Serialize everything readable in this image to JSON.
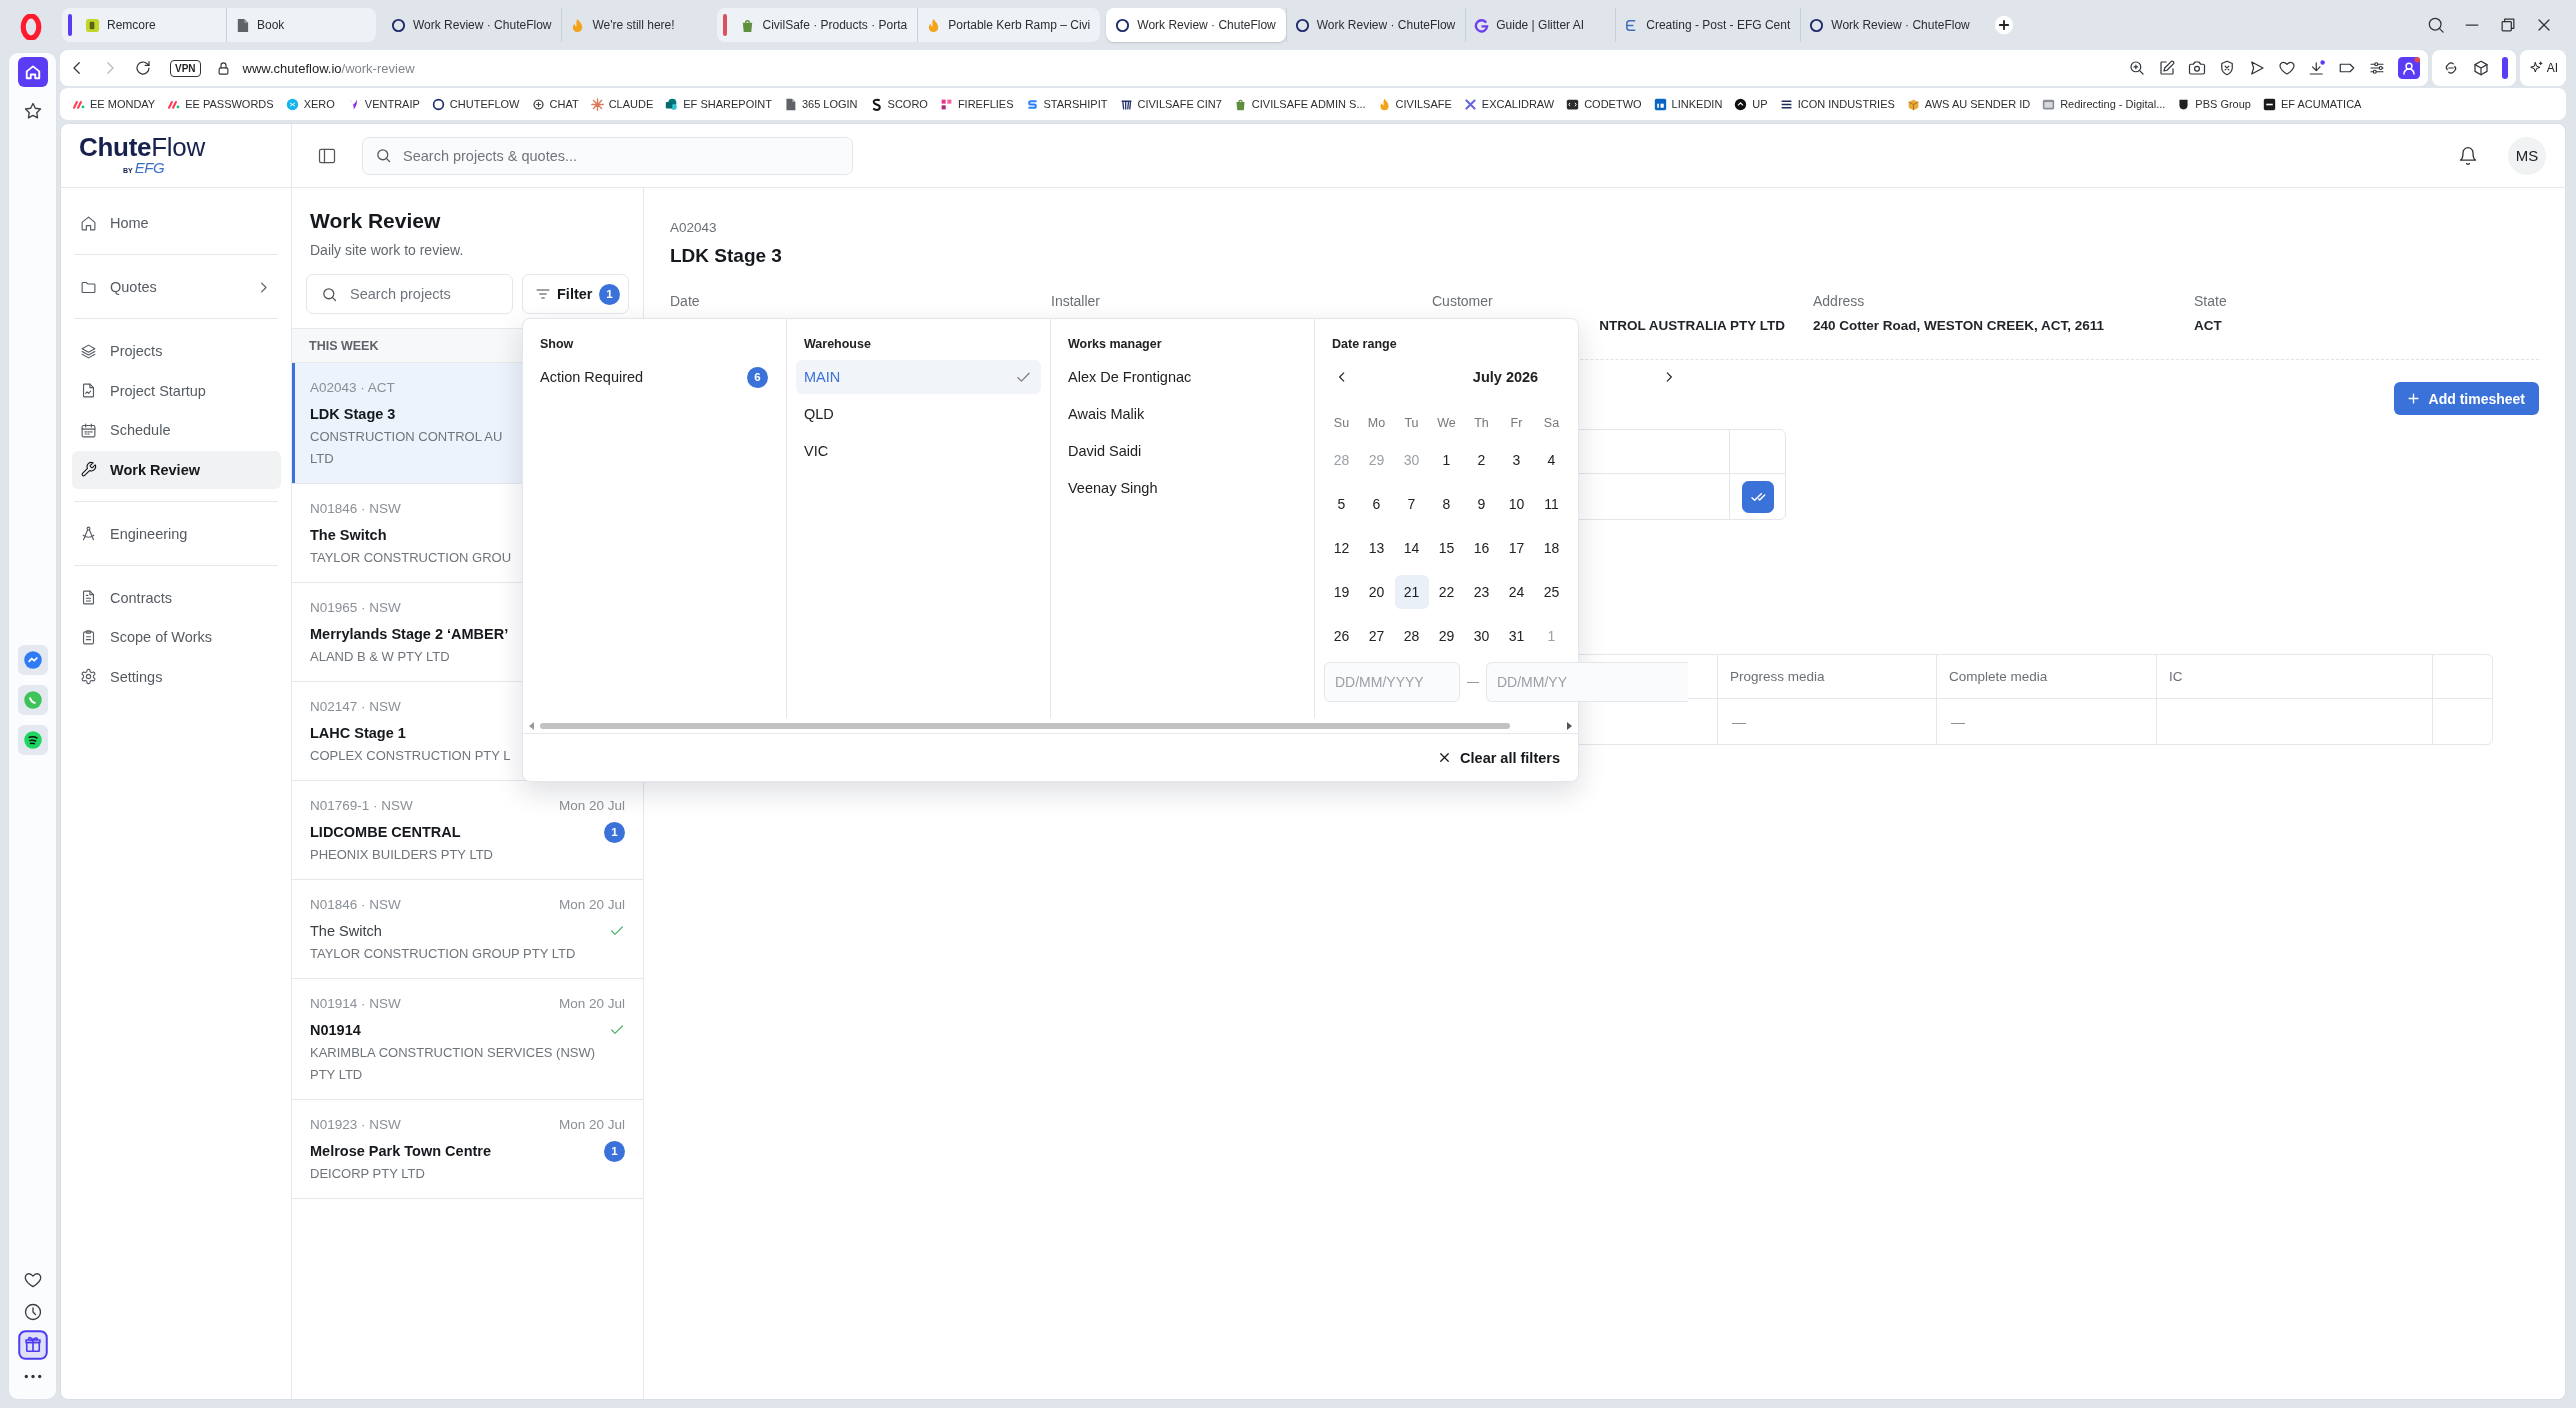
{
  "browser": {
    "tab_groups": [
      {
        "color": "#5b3cf5",
        "tabs": [
          {
            "title": "Remcore",
            "selected": false
          },
          {
            "title": "Book",
            "selected": false
          }
        ]
      },
      {
        "tabs": [
          {
            "title": "Work Review · ChuteFlow",
            "selected": false
          },
          {
            "title": "We're still here!",
            "selected": false
          }
        ]
      },
      {
        "color": "#d9525e",
        "tabs": [
          {
            "title": "CivilSafe · Products · Porta",
            "selected": false
          },
          {
            "title": "Portable Kerb Ramp – Civi",
            "selected": false
          }
        ]
      },
      {
        "tabs": [
          {
            "title": "Work Review · ChuteFlow",
            "selected": true
          },
          {
            "title": "Work Review · ChuteFlow",
            "selected": false
          },
          {
            "title": "Guide | Glitter AI",
            "selected": false
          },
          {
            "title": "Creating - Post - EFG Cent",
            "selected": false
          },
          {
            "title": "Work Review · ChuteFlow",
            "selected": false
          }
        ]
      }
    ],
    "toolbar": {
      "vpn_label": "VPN",
      "url_host": "www.chuteflow.io",
      "url_path": "/work-review",
      "ai_label": "AI"
    },
    "bookmarks": [
      "EE MONDAY",
      "EE PASSWORDS",
      "XERO",
      "VENTRAIP",
      "CHUTEFLOW",
      "CHAT",
      "CLAUDE",
      "EF SHAREPOINT",
      "365 LOGIN",
      "SCORO",
      "FIREFLIES",
      "STARSHIPIT",
      "CIVILSAFE CIN7",
      "CIVILSAFE ADMIN S...",
      "CIVILSAFE",
      "EXCALIDRAW",
      "CODETWO",
      "LINKEDIN",
      "UP",
      "ICON INDUSTRIES",
      "AWS AU SENDER ID",
      "Redirecting - Digital...",
      "PBS Group",
      "EF ACUMATICA"
    ]
  },
  "app": {
    "logo": {
      "name": "**Chute**Flow",
      "byline": "BY",
      "brand": "EFG"
    },
    "search": {
      "placeholder": "Search projects & quotes..."
    },
    "user": {
      "initials": "MS"
    },
    "sidebar": {
      "groups": [
        {
          "items": [
            {
              "label": "Home",
              "kind": "link",
              "selected": false
            }
          ]
        },
        {
          "items": [
            {
              "label": "Quotes",
              "kind": "menu",
              "selected": false
            }
          ]
        },
        {
          "items": [
            {
              "label": "Projects",
              "kind": "link",
              "selected": false
            },
            {
              "label": "Project Startup",
              "kind": "link",
              "selected": false
            },
            {
              "label": "Schedule",
              "kind": "link",
              "selected": false
            },
            {
              "label": "Work Review",
              "kind": "link",
              "selected": true
            }
          ]
        },
        {
          "items": [
            {
              "label": "Engineering",
              "kind": "link",
              "selected": false
            }
          ]
        },
        {
          "items": [
            {
              "label": "Contracts",
              "kind": "link",
              "selected": false
            },
            {
              "label": "Scope of Works",
              "kind": "link",
              "selected": false
            }
          ]
        }
      ],
      "footer": {
        "label": "Settings",
        "selected": false
      }
    },
    "list": {
      "title": "Work Review",
      "subtitle": "Daily site work to review.",
      "search": {
        "placeholder": "Search projects"
      },
      "filter": {
        "label": "Filter",
        "count": "1"
      },
      "section": "THIS WEEK",
      "items": [
        {
          "code": "A02043 · ACT",
          "title": "LDK Stage 3",
          "customer_lines": [
            "CONSTRUCTION CONTROL AU",
            "LTD"
          ],
          "selected": true,
          "read": false
        },
        {
          "code": "N01846 · NSW",
          "title": "The Switch",
          "customer_lines": [
            "TAYLOR CONSTRUCTION GROU"
          ],
          "selected": false,
          "read": false
        },
        {
          "code": "N01965 · NSW",
          "title": "Merrylands Stage 2 ‘AMBER’",
          "customer_lines": [
            "ALAND B & W PTY LTD"
          ],
          "selected": false,
          "read": false
        },
        {
          "code": "N02147 · NSW",
          "title": "LAHC Stage 1",
          "customer_lines": [
            "COPLEX CONSTRUCTION PTY L"
          ],
          "selected": false,
          "read": false
        },
        {
          "code": "N01769-1 · NSW",
          "date": "Mon 20 Jul",
          "title": "LIDCOMBE CENTRAL",
          "status": {
            "kind": "pending",
            "count": "1"
          },
          "customer_lines": [
            "PHEONIX BUILDERS PTY LTD"
          ],
          "selected": false,
          "read": false
        },
        {
          "code": "N01846 · NSW",
          "date": "Mon 20 Jul",
          "title": "The Switch",
          "status": {
            "kind": "reviewed"
          },
          "customer_lines": [
            "TAYLOR CONSTRUCTION GROUP PTY LTD"
          ],
          "selected": false,
          "read": true
        },
        {
          "code": "N01914 · NSW",
          "date": "Mon 20 Jul",
          "title": "N01914",
          "status": {
            "kind": "reviewed"
          },
          "customer_lines": [
            "KARIMBLA CONSTRUCTION SERVICES (NSW)",
            "PTY LTD"
          ],
          "selected": false,
          "read": false
        },
        {
          "code": "N01923 · NSW",
          "date": "Mon 20 Jul",
          "title": "Melrose Park Town Centre",
          "status": {
            "kind": "pending",
            "count": "1"
          },
          "customer_lines": [
            "DEICORP PTY LTD"
          ],
          "selected": false,
          "read": false
        }
      ]
    },
    "filter_popup": {
      "columns": [
        {
          "kind": "options",
          "title": "Show",
          "options": [
            {
              "label": "Action Required",
              "count": "6",
              "selected": false
            }
          ]
        },
        {
          "kind": "options",
          "title": "Warehouse",
          "options": [
            {
              "label": "MAIN",
              "selected": true
            },
            {
              "label": "QLD",
              "selected": false
            },
            {
              "label": "VIC",
              "selected": false
            }
          ]
        },
        {
          "kind": "options",
          "title": "Works manager",
          "options": [
            {
              "label": "Alex De Frontignac",
              "selected": false
            },
            {
              "label": "Awais Malik",
              "selected": false
            },
            {
              "label": "David Saidi",
              "selected": false
            },
            {
              "label": "Veenay Singh",
              "selected": false
            }
          ]
        },
        {
          "kind": "calendar",
          "title": "Date range",
          "month": "July 2026",
          "weekdays": [
            "Su",
            "Mo",
            "Tu",
            "We",
            "Th",
            "Fr",
            "Sa"
          ],
          "weeks": [
            [
              {
                "day": "28",
                "muted": true,
                "today": false
              },
              {
                "day": "29",
                "muted": true,
                "today": false
              },
              {
                "day": "30",
                "muted": true,
                "today": false
              },
              {
                "day": "1",
                "muted": false,
                "today": false
              },
              {
                "day": "2",
                "muted": false,
                "today": false
              },
              {
                "day": "3",
                "muted": false,
                "today": false
              },
              {
                "day": "4",
                "muted": false,
                "today": false
              }
            ],
            [
              {
                "day": "5",
                "muted": false,
                "today": false
              },
              {
                "day": "6",
                "muted": false,
                "today": false
              },
              {
                "day": "7",
                "muted": false,
                "today": false
              },
              {
                "day": "8",
                "muted": false,
                "today": false
              },
              {
                "day": "9",
                "muted": false,
                "today": false
              },
              {
                "day": "10",
                "muted": false,
                "today": false
              },
              {
                "day": "11",
                "muted": false,
                "today": false
              }
            ],
            [
              {
                "day": "12",
                "muted": false,
                "today": false
              },
              {
                "day": "13",
                "muted": false,
                "today": false
              },
              {
                "day": "14",
                "muted": false,
                "today": false
              },
              {
                "day": "15",
                "muted": false,
                "today": false
              },
              {
                "day": "16",
                "muted": false,
                "today": false
              },
              {
                "day": "17",
                "muted": false,
                "today": false
              },
              {
                "day": "18",
                "muted": false,
                "today": false
              }
            ],
            [
              {
                "day": "19",
                "muted": false,
                "today": false
              },
              {
                "day": "20",
                "muted": false,
                "today": false
              },
              {
                "day": "21",
                "muted": false,
                "today": true
              },
              {
                "day": "22",
                "muted": false,
                "today": false
              },
              {
                "day": "23",
                "muted": false,
                "today": false
              },
              {
                "day": "24",
                "muted": false,
                "today": false
              },
              {
                "day": "25",
                "muted": false,
                "today": false
              }
            ],
            [
              {
                "day": "26",
                "muted": false,
                "today": false
              },
              {
                "day": "27",
                "muted": false,
                "today": false
              },
              {
                "day": "28",
                "muted": false,
                "today": false
              },
              {
                "day": "29",
                "muted": false,
                "today": false
              },
              {
                "day": "30",
                "muted": false,
                "today": false
              },
              {
                "day": "31",
                "muted": false,
                "today": false
              },
              {
                "day": "1",
                "muted": true,
                "today": false
              }
            ]
          ],
          "from_placeholder": "DD/MM/YYYY",
          "to_placeholder": "DD/MM/YY"
        }
      ],
      "clear_label": "Clear all filters"
    },
    "detail": {
      "code": "A02043",
      "title": "LDK Stage 3",
      "fields": [
        {
          "label": "Date"
        },
        {
          "label": "Installer"
        },
        {
          "label": "Customer",
          "value": "NTROL AUSTRALIA PTY LTD"
        },
        {
          "label": "Address",
          "value": "240 Cotter Road, WESTON CREEK, ACT, 2611"
        },
        {
          "label": "State",
          "value": "ACT"
        }
      ],
      "add_timesheet": "Add timesheet",
      "timesheet_rows": [
        {
          "approved": true
        }
      ],
      "media_table": {
        "columns": [
          "Progress media",
          "Complete media",
          "IC"
        ],
        "rows": [
          [
            "—",
            "—"
          ]
        ]
      }
    }
  }
}
